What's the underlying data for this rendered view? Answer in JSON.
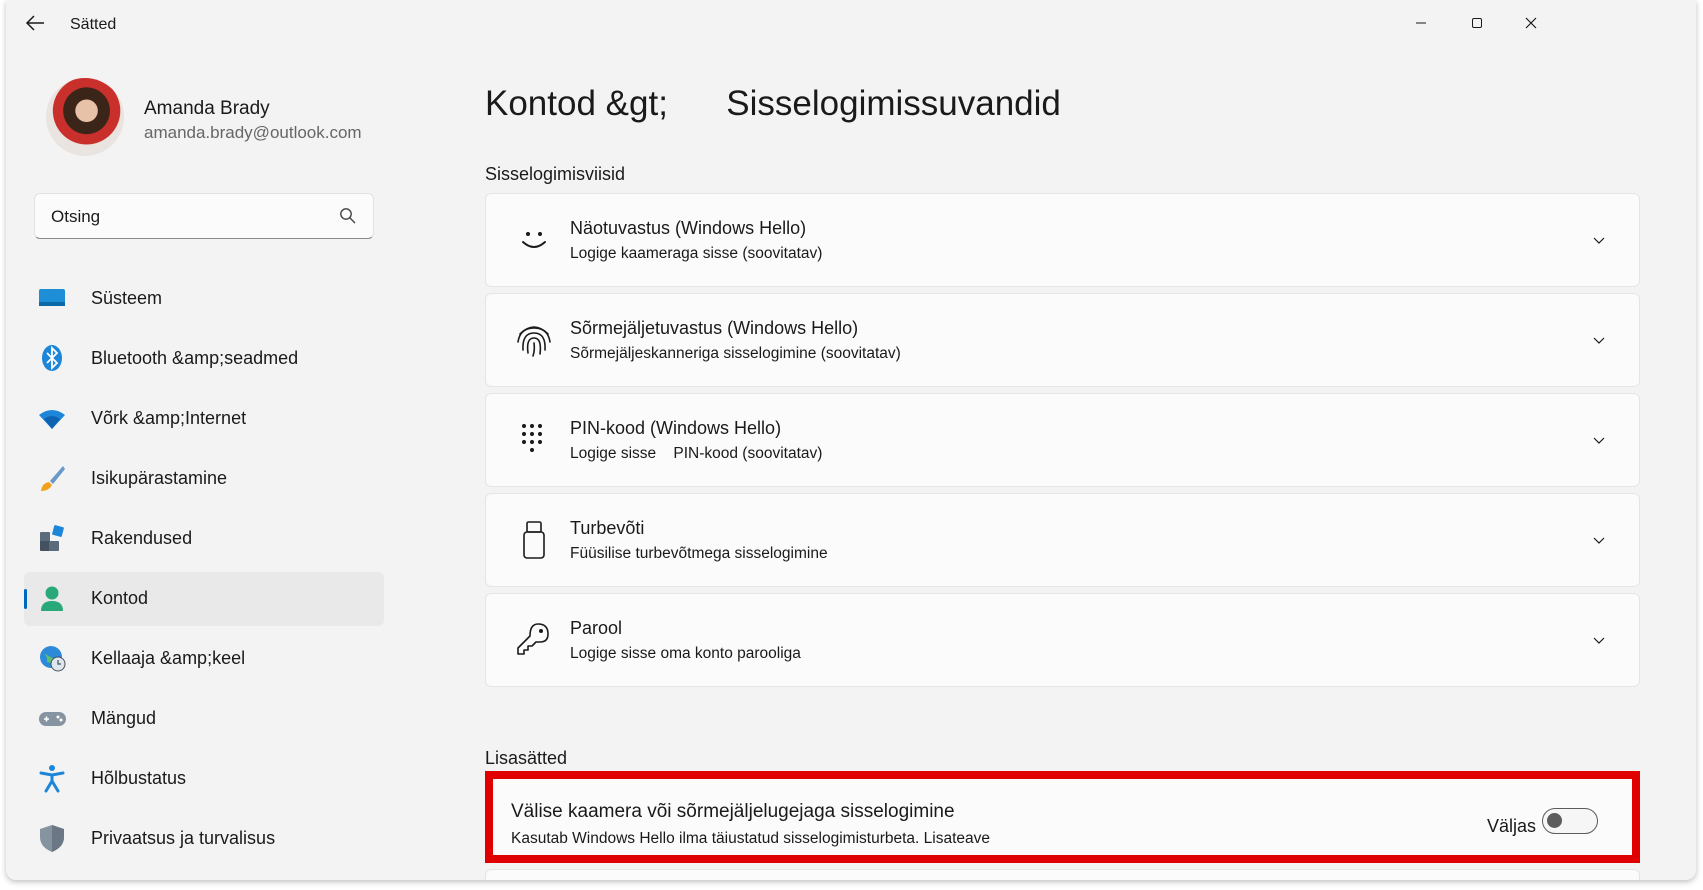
{
  "window": {
    "title": "Sätted"
  },
  "profile": {
    "name": "Amanda Brady",
    "email": "amanda.brady@outlook.com"
  },
  "search": {
    "placeholder": "Otsing"
  },
  "sidebar": {
    "items": [
      {
        "label": "Süsteem",
        "icon": "monitor-icon"
      },
      {
        "label": "Bluetooth &amp;seadmed",
        "icon": "bluetooth-icon"
      },
      {
        "label": "Võrk &amp;Internet",
        "icon": "wifi-icon"
      },
      {
        "label": "Isikupärastamine",
        "icon": "paintbrush-icon"
      },
      {
        "label": "Rakendused",
        "icon": "apps-icon"
      },
      {
        "label": "Kontod",
        "icon": "person-icon",
        "active": true
      },
      {
        "label": "Kellaaja &amp;keel",
        "icon": "globe-clock-icon"
      },
      {
        "label": "Mängud",
        "icon": "gamepad-icon"
      },
      {
        "label": "Hõlbustatus",
        "icon": "accessibility-icon"
      },
      {
        "label": "Privaatsus ja turvalisus",
        "icon": "shield-icon"
      }
    ]
  },
  "page": {
    "breadcrumb_parent": "Kontod &gt;",
    "title": "Sisselogimissuvandid"
  },
  "signin": {
    "section_title": "Sisselogimisviisid",
    "methods": [
      {
        "title": "Näotuvastus (Windows Hello)",
        "subtitle": "Logige kaameraga sisse (soovitatav)",
        "icon": "face-icon"
      },
      {
        "title": "Sõrmejäljetuvastus (Windows Hello)",
        "subtitle": "Sõrmejäljeskanneriga sisselogimine (soovitatav)",
        "icon": "fingerprint-icon"
      },
      {
        "title": "PIN-kood (Windows Hello)",
        "subtitle": "Logige sisse    PIN-kood (soovitatav)",
        "icon": "keypad-icon"
      },
      {
        "title": "Turbevõti",
        "subtitle": "Füüsilise turbevõtmega sisselogimine",
        "icon": "usb-key-icon"
      },
      {
        "title": "Parool",
        "subtitle": "Logige sisse oma konto parooliga",
        "icon": "key-icon"
      }
    ]
  },
  "additional": {
    "section_title": "Lisasätted",
    "external": {
      "title": "Välise kaamera või sõrmejäljelugejaga sisselogimine",
      "subtitle": "Kasutab Windows Hello ilma täiustatud sisselogimisturbeta. Lisateave",
      "toggle_state": "Väljas",
      "toggle_on": false
    }
  },
  "colors": {
    "accent": "#0067c0",
    "highlight": "#e00000",
    "background": "#f3f3f3",
    "card": "#fbfbfb"
  }
}
